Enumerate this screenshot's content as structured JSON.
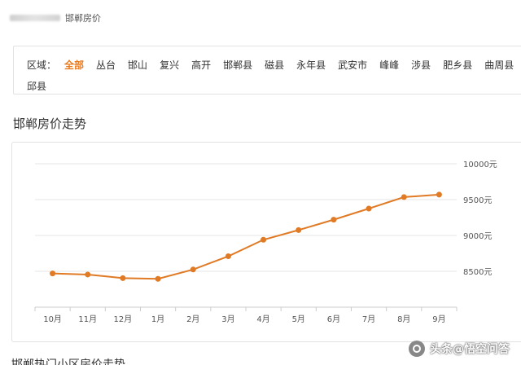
{
  "breadcrumb": {
    "current": "邯郸房价"
  },
  "filter": {
    "label": "区域：",
    "options": [
      "全部",
      "丛台",
      "邯山",
      "复兴",
      "高开",
      "邯郸县",
      "磁县",
      "永年县",
      "武安市",
      "峰峰",
      "涉县",
      "肥乡县",
      "曲周县"
    ],
    "active_index": 0,
    "wrap_option": "邱县"
  },
  "section": {
    "title": "邯郸房价走势",
    "next_title": "邯郸热门小区房价走势"
  },
  "watermark": {
    "text": "头条@悟空问答"
  },
  "colors": {
    "accent": "#e87b1e",
    "line": "#e07a24",
    "grid": "#e6e6e6"
  },
  "chart_data": {
    "type": "line",
    "categories": [
      "10月",
      "11月",
      "12月",
      "1月",
      "2月",
      "3月",
      "4月",
      "5月",
      "6月",
      "7月",
      "8月",
      "9月"
    ],
    "series": [
      {
        "values": [
          8470,
          8455,
          8405,
          8395,
          8525,
          8710,
          8940,
          9075,
          9220,
          9375,
          9535,
          9570
        ]
      }
    ],
    "y_ticks": [
      "10000元",
      "9500元",
      "9000元",
      "8500元"
    ],
    "ylim": [
      8000,
      10000
    ],
    "axis_position": "right",
    "grid": true
  }
}
